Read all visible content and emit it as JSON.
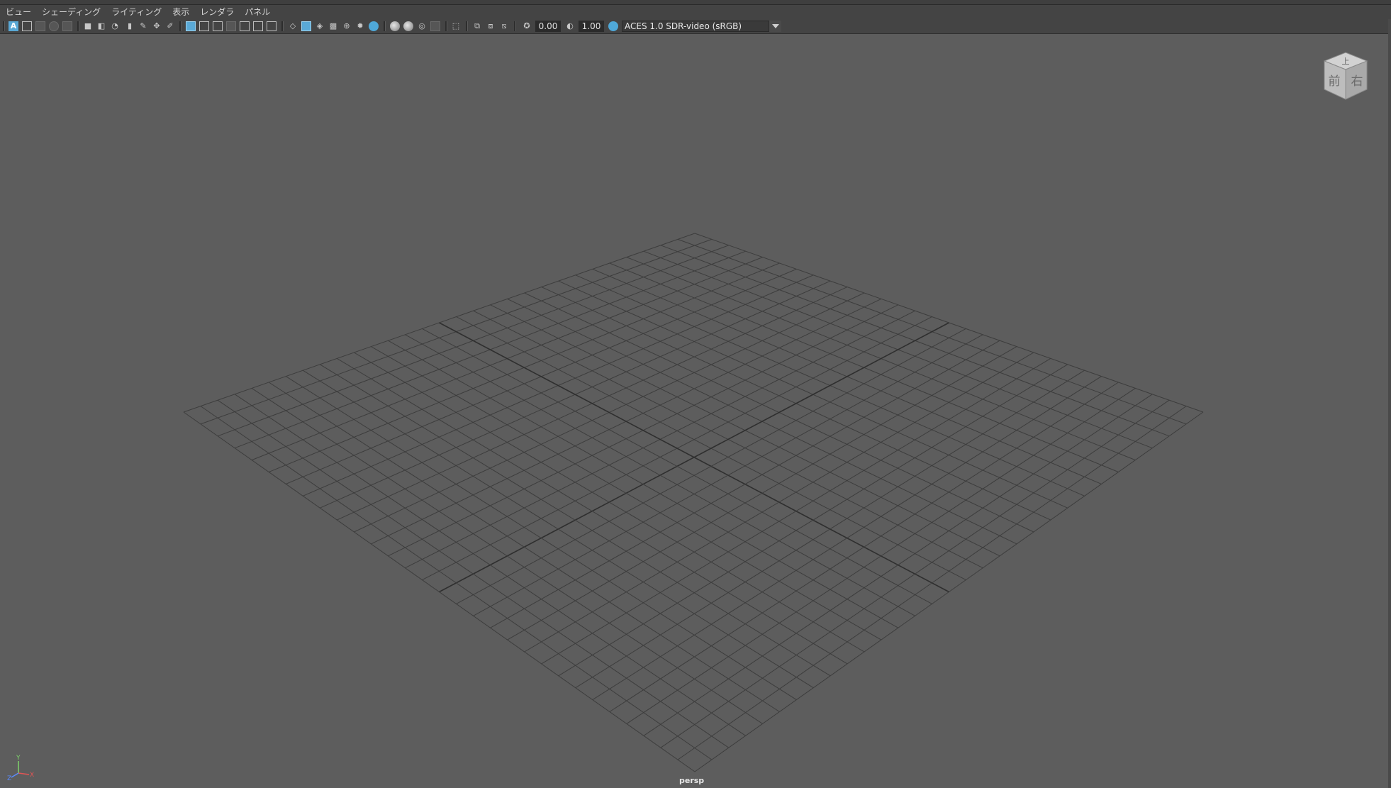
{
  "menubar": {
    "items": [
      {
        "label": "ビュー"
      },
      {
        "label": "シェーディング"
      },
      {
        "label": "ライティング"
      },
      {
        "label": "表示"
      },
      {
        "label": "レンダラ"
      },
      {
        "label": "パネル"
      }
    ]
  },
  "toolbar": {
    "select_camera_icon_text": "A",
    "exposure_value": "0.00",
    "gamma_value": "1.00",
    "color_space": "ACES 1.0 SDR-video (sRGB)"
  },
  "viewport": {
    "camera_label": "persp",
    "view_cube": {
      "front": "前",
      "right": "右",
      "top": "上"
    },
    "axis": {
      "x": "X",
      "y": "Y",
      "z": "Z"
    },
    "colors": {
      "background": "#5d5d5d",
      "grid": "#3d3d3d",
      "grid_axis": "#2f2f2f"
    }
  }
}
